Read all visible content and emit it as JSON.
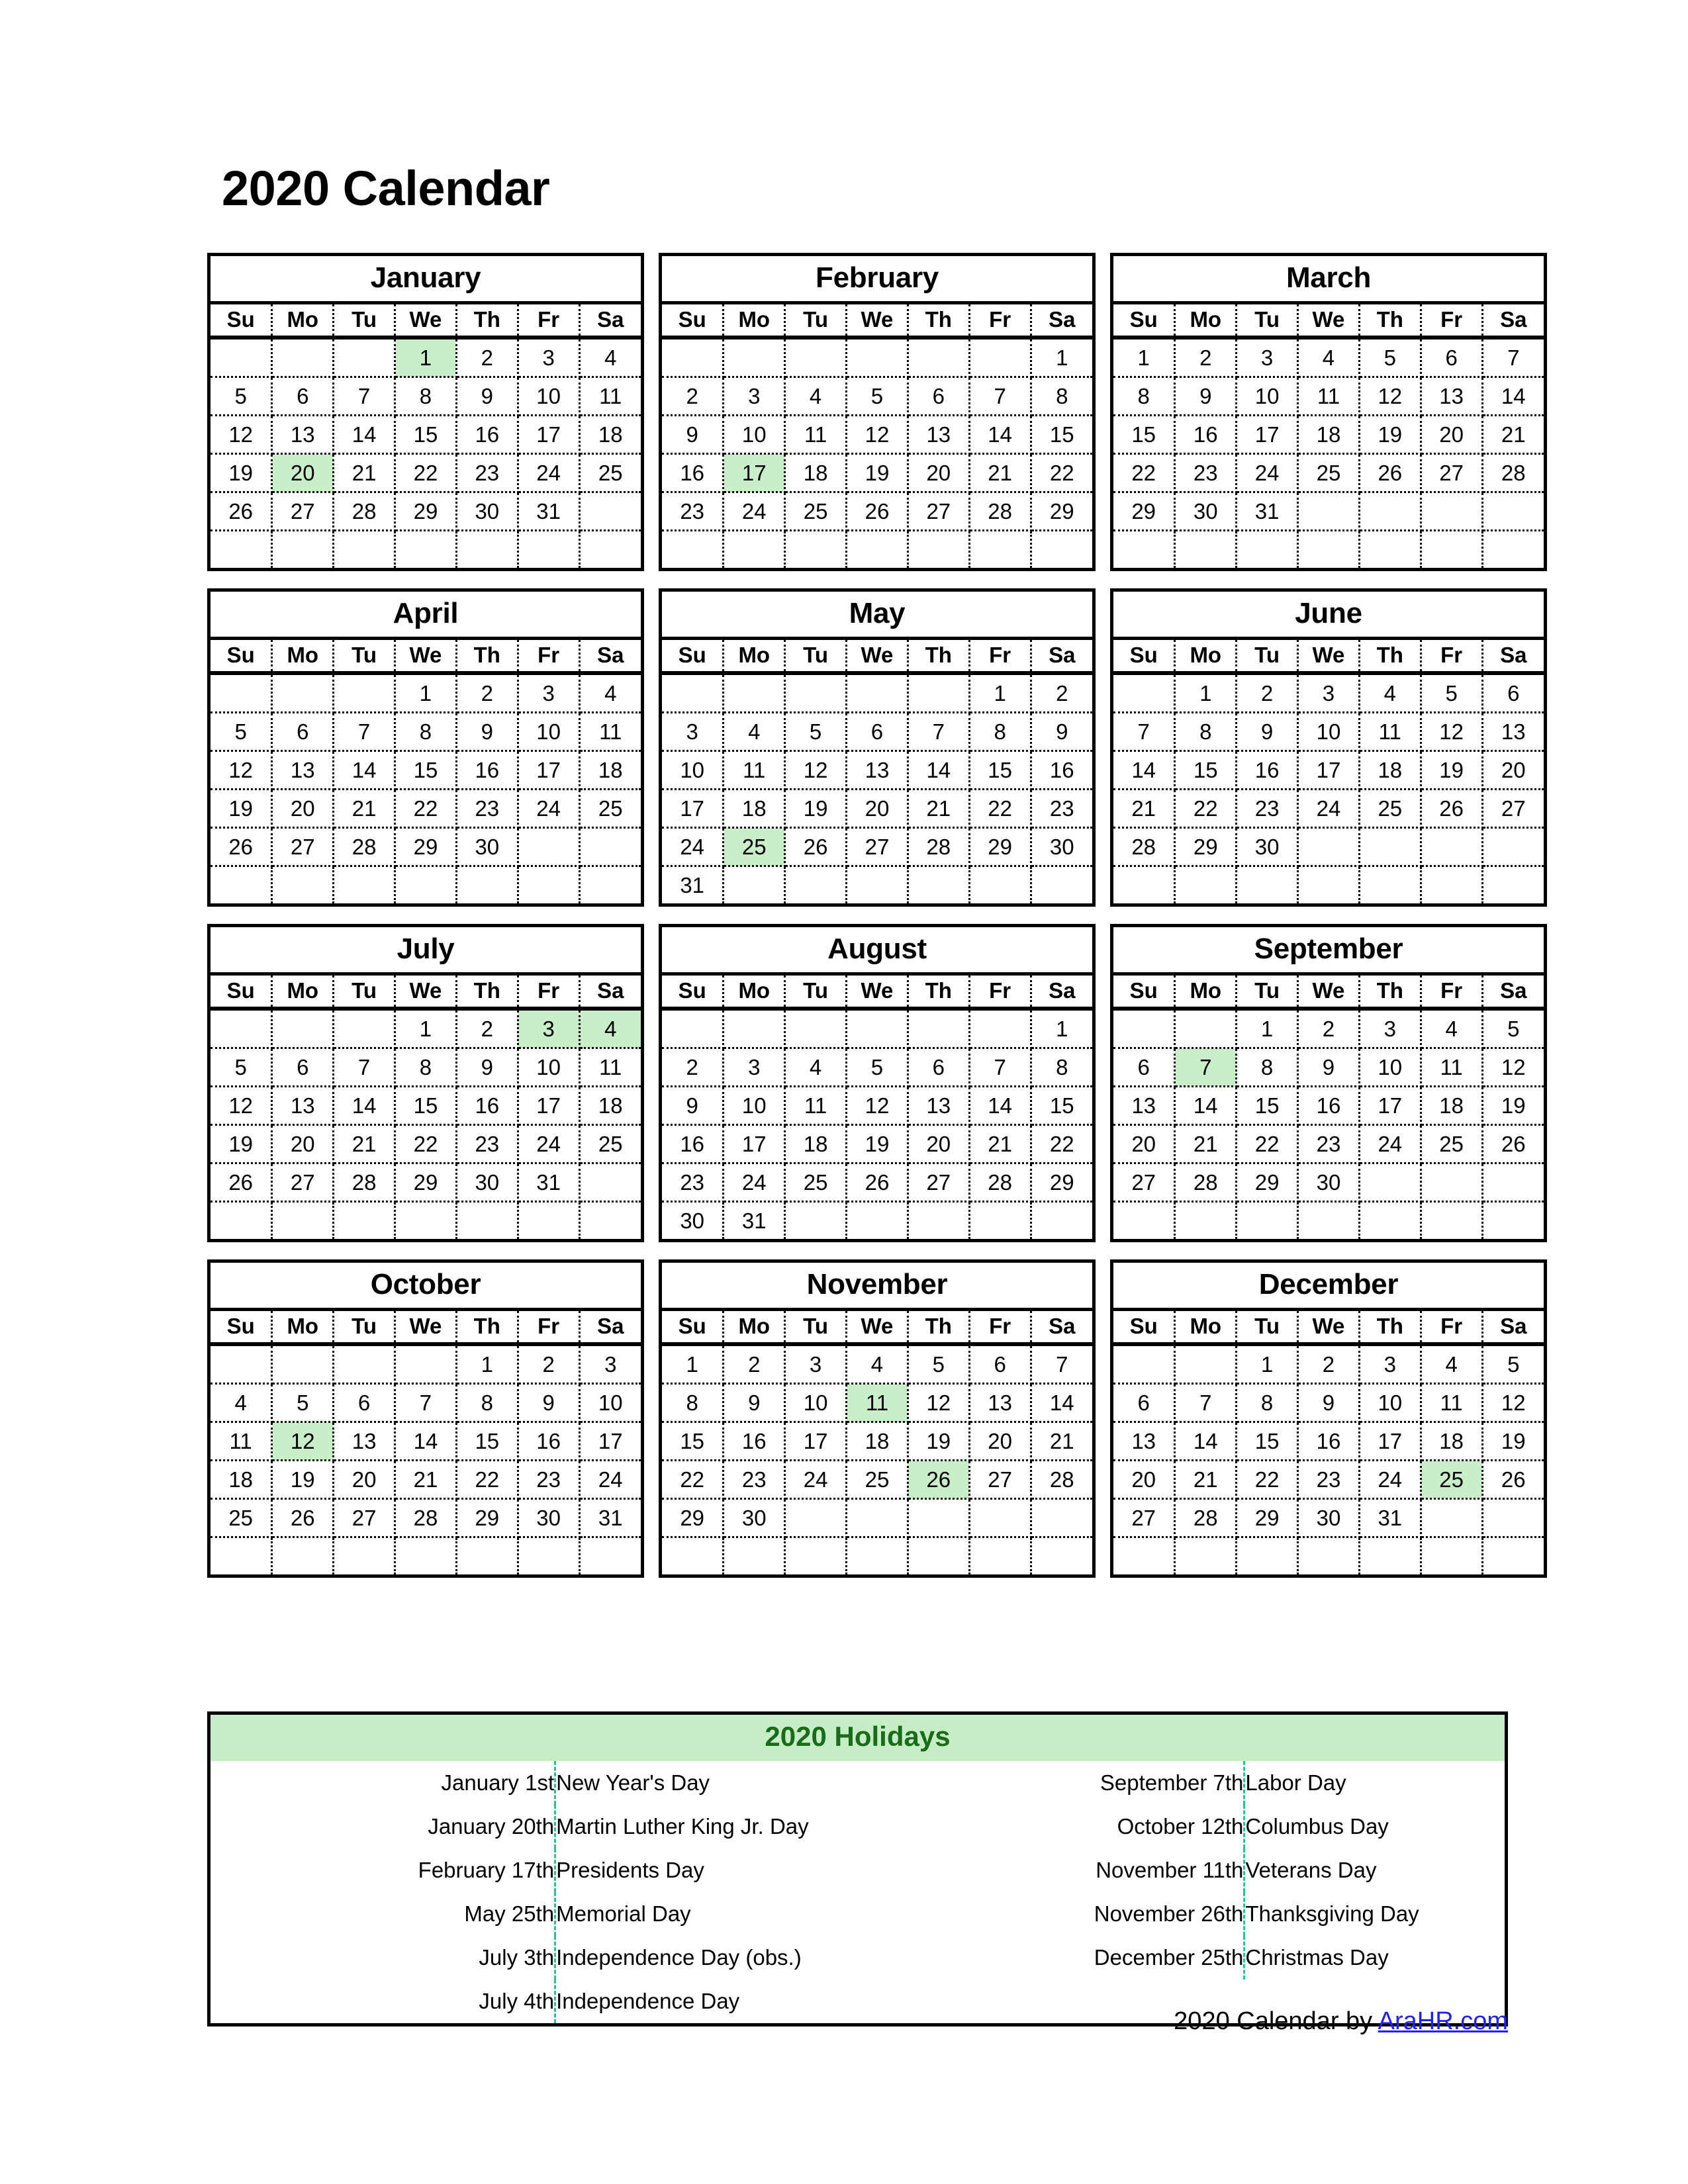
{
  "title": "2020 Calendar",
  "colors": {
    "highlight": "#c9efc9",
    "holidays_header_bg": "#c6edc6",
    "holidays_header_text": "#1a6b1a",
    "divider": "#1ec98a",
    "link": "#2222ee"
  },
  "weekdays": [
    "Su",
    "Mo",
    "Tu",
    "We",
    "Th",
    "Fr",
    "Sa"
  ],
  "months": [
    {
      "name": "January",
      "weeks": [
        [
          "",
          "",
          "",
          "1",
          "2",
          "3",
          "4"
        ],
        [
          "5",
          "6",
          "7",
          "8",
          "9",
          "10",
          "11"
        ],
        [
          "12",
          "13",
          "14",
          "15",
          "16",
          "17",
          "18"
        ],
        [
          "19",
          "20",
          "21",
          "22",
          "23",
          "24",
          "25"
        ],
        [
          "26",
          "27",
          "28",
          "29",
          "30",
          "31",
          ""
        ],
        [
          "",
          "",
          "",
          "",
          "",
          "",
          ""
        ]
      ],
      "highlights": [
        "1",
        "20"
      ]
    },
    {
      "name": "February",
      "weeks": [
        [
          "",
          "",
          "",
          "",
          "",
          "",
          "1"
        ],
        [
          "2",
          "3",
          "4",
          "5",
          "6",
          "7",
          "8"
        ],
        [
          "9",
          "10",
          "11",
          "12",
          "13",
          "14",
          "15"
        ],
        [
          "16",
          "17",
          "18",
          "19",
          "20",
          "21",
          "22"
        ],
        [
          "23",
          "24",
          "25",
          "26",
          "27",
          "28",
          "29"
        ],
        [
          "",
          "",
          "",
          "",
          "",
          "",
          ""
        ]
      ],
      "highlights": [
        "17"
      ]
    },
    {
      "name": "March",
      "weeks": [
        [
          "1",
          "2",
          "3",
          "4",
          "5",
          "6",
          "7"
        ],
        [
          "8",
          "9",
          "10",
          "11",
          "12",
          "13",
          "14"
        ],
        [
          "15",
          "16",
          "17",
          "18",
          "19",
          "20",
          "21"
        ],
        [
          "22",
          "23",
          "24",
          "25",
          "26",
          "27",
          "28"
        ],
        [
          "29",
          "30",
          "31",
          "",
          "",
          "",
          ""
        ],
        [
          "",
          "",
          "",
          "",
          "",
          "",
          ""
        ]
      ],
      "highlights": []
    },
    {
      "name": "April",
      "weeks": [
        [
          "",
          "",
          "",
          "1",
          "2",
          "3",
          "4"
        ],
        [
          "5",
          "6",
          "7",
          "8",
          "9",
          "10",
          "11"
        ],
        [
          "12",
          "13",
          "14",
          "15",
          "16",
          "17",
          "18"
        ],
        [
          "19",
          "20",
          "21",
          "22",
          "23",
          "24",
          "25"
        ],
        [
          "26",
          "27",
          "28",
          "29",
          "30",
          "",
          ""
        ],
        [
          "",
          "",
          "",
          "",
          "",
          "",
          ""
        ]
      ],
      "highlights": []
    },
    {
      "name": "May",
      "weeks": [
        [
          "",
          "",
          "",
          "",
          "",
          "1",
          "2"
        ],
        [
          "3",
          "4",
          "5",
          "6",
          "7",
          "8",
          "9"
        ],
        [
          "10",
          "11",
          "12",
          "13",
          "14",
          "15",
          "16"
        ],
        [
          "17",
          "18",
          "19",
          "20",
          "21",
          "22",
          "23"
        ],
        [
          "24",
          "25",
          "26",
          "27",
          "28",
          "29",
          "30"
        ],
        [
          "31",
          "",
          "",
          "",
          "",
          "",
          ""
        ]
      ],
      "highlights": [
        "25"
      ]
    },
    {
      "name": "June",
      "weeks": [
        [
          "",
          "1",
          "2",
          "3",
          "4",
          "5",
          "6"
        ],
        [
          "7",
          "8",
          "9",
          "10",
          "11",
          "12",
          "13"
        ],
        [
          "14",
          "15",
          "16",
          "17",
          "18",
          "19",
          "20"
        ],
        [
          "21",
          "22",
          "23",
          "24",
          "25",
          "26",
          "27"
        ],
        [
          "28",
          "29",
          "30",
          "",
          "",
          "",
          ""
        ],
        [
          "",
          "",
          "",
          "",
          "",
          "",
          ""
        ]
      ],
      "highlights": []
    },
    {
      "name": "July",
      "weeks": [
        [
          "",
          "",
          "",
          "1",
          "2",
          "3",
          "4"
        ],
        [
          "5",
          "6",
          "7",
          "8",
          "9",
          "10",
          "11"
        ],
        [
          "12",
          "13",
          "14",
          "15",
          "16",
          "17",
          "18"
        ],
        [
          "19",
          "20",
          "21",
          "22",
          "23",
          "24",
          "25"
        ],
        [
          "26",
          "27",
          "28",
          "29",
          "30",
          "31",
          ""
        ],
        [
          "",
          "",
          "",
          "",
          "",
          "",
          ""
        ]
      ],
      "highlights": [
        "3",
        "4"
      ]
    },
    {
      "name": "August",
      "weeks": [
        [
          "",
          "",
          "",
          "",
          "",
          "",
          "1"
        ],
        [
          "2",
          "3",
          "4",
          "5",
          "6",
          "7",
          "8"
        ],
        [
          "9",
          "10",
          "11",
          "12",
          "13",
          "14",
          "15"
        ],
        [
          "16",
          "17",
          "18",
          "19",
          "20",
          "21",
          "22"
        ],
        [
          "23",
          "24",
          "25",
          "26",
          "27",
          "28",
          "29"
        ],
        [
          "30",
          "31",
          "",
          "",
          "",
          "",
          ""
        ]
      ],
      "highlights": []
    },
    {
      "name": "September",
      "weeks": [
        [
          "",
          "",
          "1",
          "2",
          "3",
          "4",
          "5"
        ],
        [
          "6",
          "7",
          "8",
          "9",
          "10",
          "11",
          "12"
        ],
        [
          "13",
          "14",
          "15",
          "16",
          "17",
          "18",
          "19"
        ],
        [
          "20",
          "21",
          "22",
          "23",
          "24",
          "25",
          "26"
        ],
        [
          "27",
          "28",
          "29",
          "30",
          "",
          "",
          ""
        ],
        [
          "",
          "",
          "",
          "",
          "",
          "",
          ""
        ]
      ],
      "highlights": [
        "7"
      ]
    },
    {
      "name": "October",
      "weeks": [
        [
          "",
          "",
          "",
          "",
          "1",
          "2",
          "3"
        ],
        [
          "4",
          "5",
          "6",
          "7",
          "8",
          "9",
          "10"
        ],
        [
          "11",
          "12",
          "13",
          "14",
          "15",
          "16",
          "17"
        ],
        [
          "18",
          "19",
          "20",
          "21",
          "22",
          "23",
          "24"
        ],
        [
          "25",
          "26",
          "27",
          "28",
          "29",
          "30",
          "31"
        ],
        [
          "",
          "",
          "",
          "",
          "",
          "",
          ""
        ]
      ],
      "highlights": [
        "12"
      ]
    },
    {
      "name": "November",
      "weeks": [
        [
          "1",
          "2",
          "3",
          "4",
          "5",
          "6",
          "7"
        ],
        [
          "8",
          "9",
          "10",
          "11",
          "12",
          "13",
          "14"
        ],
        [
          "15",
          "16",
          "17",
          "18",
          "19",
          "20",
          "21"
        ],
        [
          "22",
          "23",
          "24",
          "25",
          "26",
          "27",
          "28"
        ],
        [
          "29",
          "30",
          "",
          "",
          "",
          "",
          ""
        ],
        [
          "",
          "",
          "",
          "",
          "",
          "",
          ""
        ]
      ],
      "highlights": [
        "11",
        "26"
      ]
    },
    {
      "name": "December",
      "weeks": [
        [
          "",
          "",
          "1",
          "2",
          "3",
          "4",
          "5"
        ],
        [
          "6",
          "7",
          "8",
          "9",
          "10",
          "11",
          "12"
        ],
        [
          "13",
          "14",
          "15",
          "16",
          "17",
          "18",
          "19"
        ],
        [
          "20",
          "21",
          "22",
          "23",
          "24",
          "25",
          "26"
        ],
        [
          "27",
          "28",
          "29",
          "30",
          "31",
          "",
          ""
        ],
        [
          "",
          "",
          "",
          "",
          "",
          "",
          ""
        ]
      ],
      "highlights": [
        "25"
      ]
    }
  ],
  "holidays": {
    "header": "2020 Holidays",
    "rows": [
      {
        "left_date": "January 1st",
        "left_name": "New Year's Day",
        "right_date": "September 7th",
        "right_name": "Labor Day"
      },
      {
        "left_date": "January 20th",
        "left_name": "Martin Luther King Jr. Day",
        "right_date": "October 12th",
        "right_name": "Columbus Day"
      },
      {
        "left_date": "February 17th",
        "left_name": "Presidents Day",
        "right_date": "November 11th",
        "right_name": "Veterans Day"
      },
      {
        "left_date": "May 25th",
        "left_name": "Memorial Day",
        "right_date": "November 26th",
        "right_name": "Thanksgiving Day"
      },
      {
        "left_date": "July 3th",
        "left_name": "Independence Day (obs.)",
        "right_date": "December 25th",
        "right_name": "Christmas Day"
      },
      {
        "left_date": "July 4th",
        "left_name": "Independence Day",
        "right_date": "",
        "right_name": ""
      }
    ]
  },
  "footer": {
    "prefix": "2020 Calendar by ",
    "link_text": "AraHR.com"
  }
}
